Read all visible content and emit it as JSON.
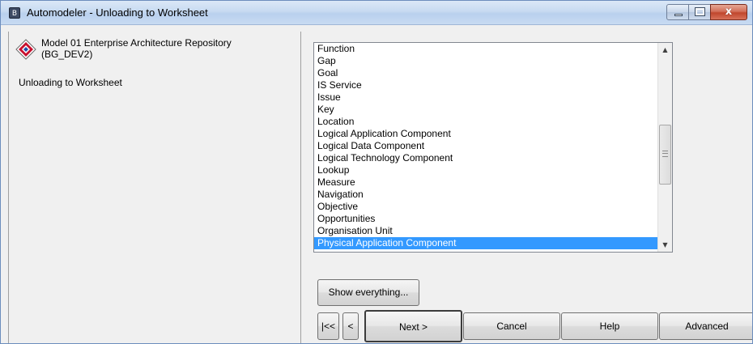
{
  "window": {
    "title": "Automodeler - Unloading to Worksheet",
    "app_icon_glyph": "B",
    "controls": {
      "minimize_icon": "minimize-icon",
      "maximize_icon": "maximize-icon",
      "close_label": "x"
    }
  },
  "left_panel": {
    "repository_line1": "Model 01 Enterprise Architecture Repository",
    "repository_line2": "(BG_DEV2)",
    "repository_icon": "repository-diamond-icon",
    "status": "Unloading to Worksheet"
  },
  "list": {
    "items": [
      "Function",
      "Gap",
      "Goal",
      "IS Service",
      "Issue",
      "Key",
      "Location",
      "Logical Application Component",
      "Logical Data Component",
      "Logical Technology Component",
      "Lookup",
      "Measure",
      "Navigation",
      "Objective",
      "Opportunities",
      "Organisation Unit",
      "Physical Application Component"
    ],
    "selected": "Physical Application Component",
    "scroll_up_glyph": "▲",
    "scroll_down_glyph": "▼"
  },
  "buttons": {
    "show_everything": "Show everything...",
    "first": "|<<",
    "prev": "<",
    "next": "Next >",
    "cancel": "Cancel",
    "help": "Help",
    "advanced": "Advanced"
  },
  "colors": {
    "selection": "#3399ff",
    "close_button": "#c0462d",
    "titlebar": "#c7daf1"
  }
}
